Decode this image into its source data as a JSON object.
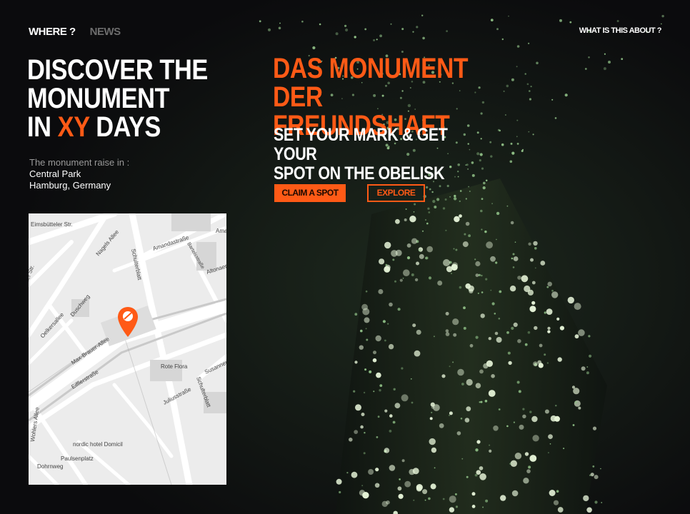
{
  "nav": {
    "where": "WHERE ?",
    "news": "NEWS"
  },
  "about_link": "WHAT IS THIS ABOUT ?",
  "headline": {
    "line1": "DISCOVER THE",
    "line2": "MONUMENT",
    "line3_pre": "IN",
    "line3_highlight": "XY",
    "line3_post": "DAYS"
  },
  "location": {
    "label": "The monument raise in :",
    "place": "Central Park",
    "city": "Hamburg, Germany"
  },
  "monument": {
    "title_line1": "DAS MONUMENT DER",
    "title_line2": "FREUNDSHAFT",
    "subtitle_line1": "SET YOUR MARK & GET YOUR",
    "subtitle_line2": "SPOT ON THE OBELISK"
  },
  "buttons": {
    "claim": "CLAIM A SPOT",
    "explore": "EXPLORE"
  },
  "map": {
    "streets": [
      "Eimsbütteler Str.",
      "Nagels Allee",
      "Schulterblatt",
      "Amandastraße",
      "Bartelsstraße",
      "Altonaer",
      "Duschweg",
      "Oelkersallee",
      "Max-Brauer-Allee",
      "Eifflerstraße",
      "Rote Flora",
      "Susannenstr.",
      "Juliusstraße",
      "Schulterblatt",
      "Wohlers Allee",
      "nordic hotel Domicil",
      "Paulsenplatz",
      "Dohrnweg",
      "Ama",
      "ler Str."
    ],
    "icons": [
      "map-pin-icon"
    ]
  },
  "colors": {
    "accent": "#ff5a16",
    "background": "#0d0d0f",
    "map_bg": "#ececec"
  }
}
